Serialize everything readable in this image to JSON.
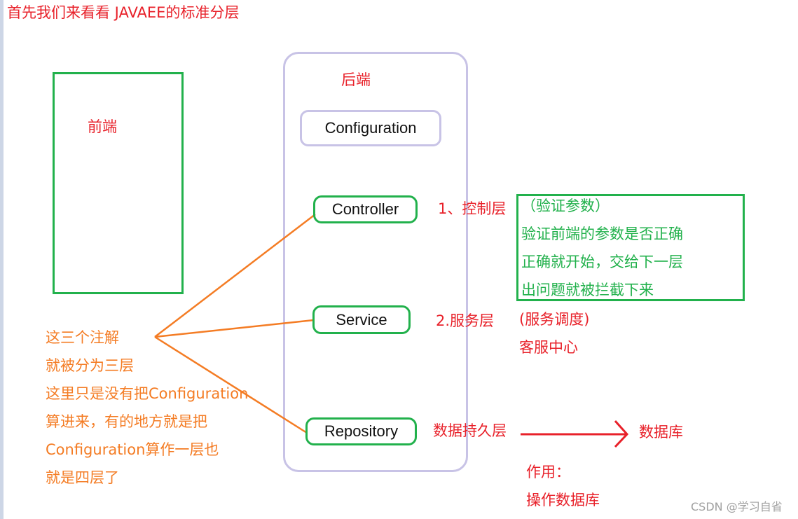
{
  "title": "首先我们来看看  JAVAEE的标准分层",
  "frontend": {
    "label": "前端"
  },
  "backend": {
    "label": "后端",
    "layers": [
      {
        "name": "Configuration"
      },
      {
        "name": "Controller",
        "description": "1、控制层"
      },
      {
        "name": "Service",
        "description": "2.服务层"
      },
      {
        "name": "Repository",
        "description": "数据持久层"
      }
    ]
  },
  "controller_note": {
    "lines": [
      "（验证参数）",
      "验证前端的参数是否正确",
      "正确就开始，交给下一层",
      "出问题就被拦截下来"
    ]
  },
  "service_note": {
    "lines": [
      "(服务调度)",
      "客服中心"
    ]
  },
  "repository_note": {
    "target": "数据库",
    "lines": [
      "作用：",
      "操作数据库"
    ]
  },
  "annotation_note": {
    "lines": [
      "这三个注解",
      "就被分为三层",
      "这里只是没有把Configuration",
      "算进来，有的地方就是把",
      "Configuration算作一层也",
      "就是四层了"
    ]
  },
  "watermark": "CSDN @学习自省",
  "colors": {
    "title": "#e8212a",
    "green_border": "#22b14c",
    "backend_border": "#c8c3e6",
    "orange": "#f47c24",
    "red": "#e8212a"
  }
}
